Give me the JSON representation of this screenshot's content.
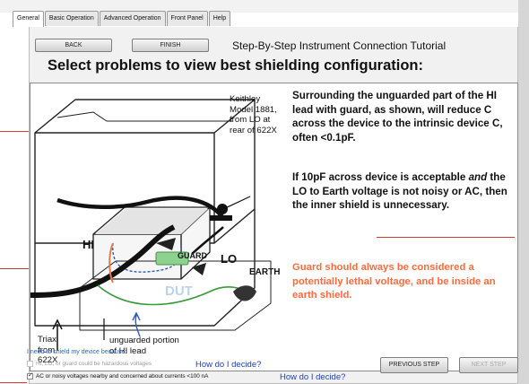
{
  "tabs": [
    {
      "label": "General",
      "active": true
    },
    {
      "label": "Basic Operation",
      "active": false
    },
    {
      "label": "Advanced Operation",
      "active": false
    },
    {
      "label": "Front Panel",
      "active": false
    },
    {
      "label": "Help",
      "active": false
    }
  ],
  "nav": {
    "back_label": "BACK",
    "finish_label": "FINISH",
    "tutorial_title": "Step-By-Step Instrument Connection Tutorial"
  },
  "main_title": "Select problems to view best shielding configuration:",
  "figure": {
    "keithley_label": "Keithley Model 1881, from LO at rear of 622X",
    "hi_label": "HI",
    "lo_label": "LO",
    "guard_label": "GUARD",
    "earth_label": "EARTH",
    "dut_label": "DUT",
    "triax_label": "Triax from 622X",
    "unguarded_label": "unguarded portion of HI lead"
  },
  "explanation": {
    "paragraph1": "Surrounding the unguarded part of the HI lead with guard, as shown, will reduce C across the device to the intrinsic device C, often <0.1pF.",
    "paragraph2_prefix": "If 10pF across device is acceptable ",
    "paragraph2_emphasis": "and",
    "paragraph2_suffix": " the LO to Earth voltage is not noisy or AC, then the inner shield is unnecessary.",
    "warning": "Guard should always be considered a potentially lethal voltage, and be inside an earth shield."
  },
  "options": {
    "heading": "I need to shield my device because:",
    "items": [
      {
        "label": "HI, LO, or guard could be hazardous voltages",
        "checked": false,
        "enabled": false
      },
      {
        "label": "AC or noisy voltages nearby and concerned about currents <100 nA",
        "checked": true,
        "enabled": true
      }
    ],
    "link1": "How do I decide?",
    "link2": "How do I decide?"
  },
  "footer": {
    "previous_label": "PREVIOUS STEP",
    "next_label": "NEXT STEP"
  },
  "colors": {
    "warning_text": "#ff6a3d",
    "link": "#2240b8",
    "heading_blue": "#2e67b3",
    "leader_red": "#d23b2a"
  }
}
